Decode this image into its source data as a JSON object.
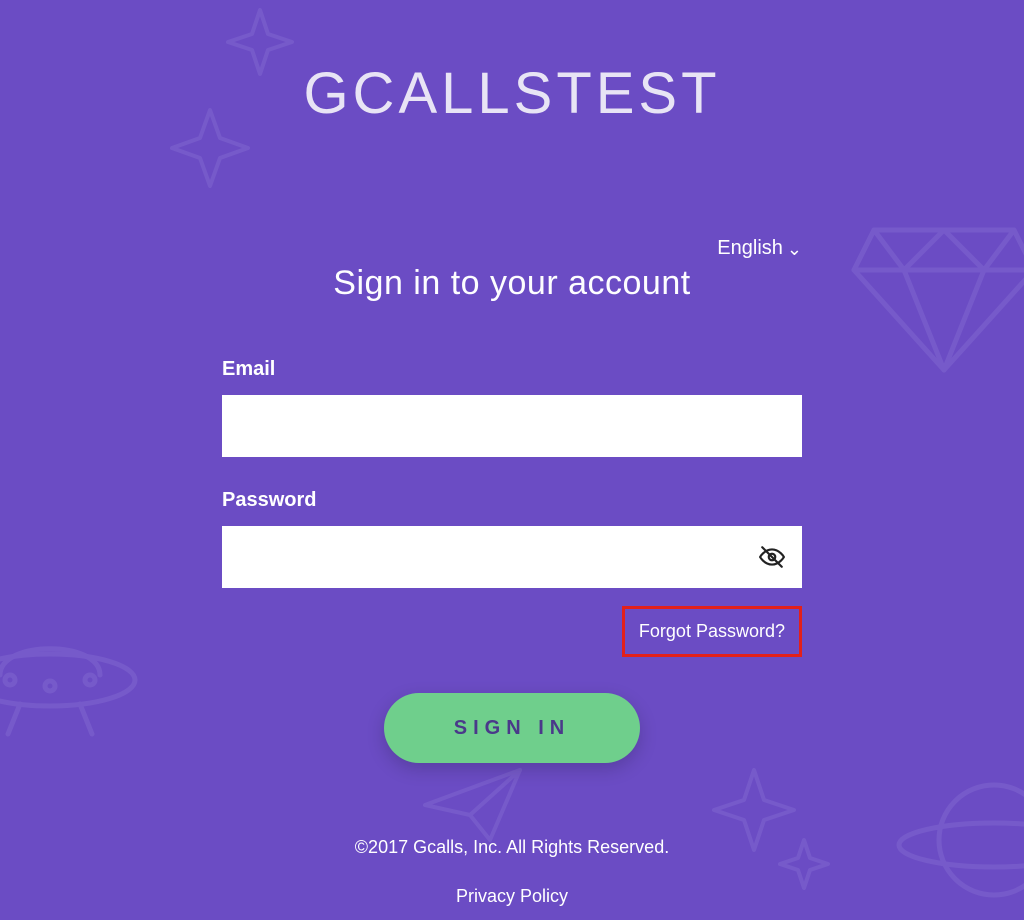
{
  "brand": "GCALLSTEST",
  "language": {
    "label": "English"
  },
  "subtitle": "Sign in to your account",
  "form": {
    "email_label": "Email",
    "password_label": "Password",
    "email_value": "",
    "password_value": "",
    "forgot": "Forgot Password?",
    "signin": "SIGN IN"
  },
  "footer": {
    "copyright": "©2017 Gcalls, Inc. All Rights Reserved.",
    "privacy": "Privacy Policy"
  }
}
